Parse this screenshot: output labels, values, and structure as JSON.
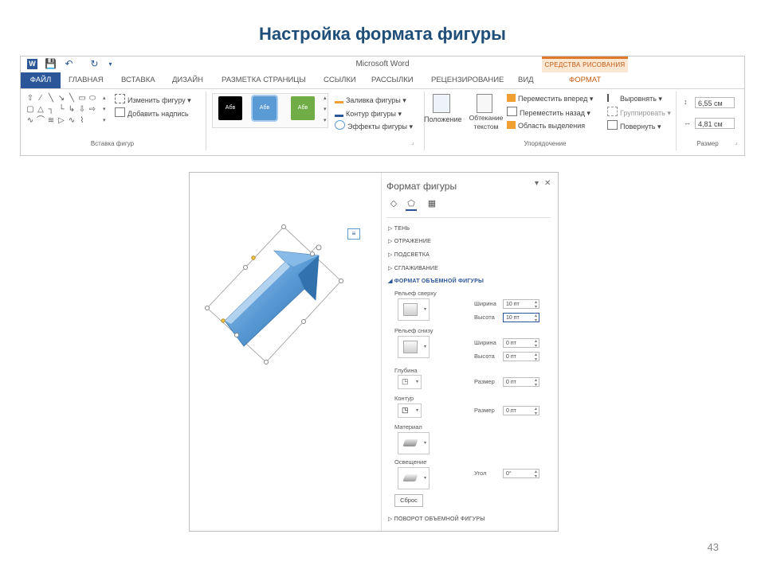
{
  "slide": {
    "title": "Настройка формата фигуры",
    "page_number": "43"
  },
  "window": {
    "title": "Microsoft Word",
    "context_tab": "СРЕДСТВА РИСОВАНИЯ"
  },
  "qat": [
    "word-logo",
    "save-icon",
    "undo-icon",
    "redo-icon",
    "customize-icon"
  ],
  "tabs": [
    "ФАЙЛ",
    "ГЛАВНАЯ",
    "ВСТАВКА",
    "ДИЗАЙН",
    "РАЗМЕТКА СТРАНИЦЫ",
    "ССЫЛКИ",
    "РАССЫЛКИ",
    "РЕЦЕНЗИРОВАНИЕ",
    "ВИД",
    "ФОРМАТ"
  ],
  "ribbon": {
    "insert_shapes": {
      "label": "Вставка фигур",
      "edit_shape": "Изменить фигуру",
      "add_text": "Добавить надпись"
    },
    "styles": {
      "samples": [
        "Абв",
        "Абв",
        "Абв"
      ],
      "sample_colors": [
        "#000000",
        "#5b9bd5",
        "#70ad47"
      ],
      "fill": "Заливка фигуры",
      "outline": "Контур фигуры",
      "effects": "Эффекты фигуры"
    },
    "arrange": {
      "label": "Упорядочение",
      "position": "Положение",
      "wrap": "Обтекание текстом",
      "bring_forward": "Переместить вперед",
      "send_backward": "Переместить назад",
      "selection_pane": "Область выделения",
      "align": "Выровнять",
      "group": "Группировать",
      "rotate": "Повернуть"
    },
    "size": {
      "label": "Размер",
      "height": "6,55 см",
      "width": "4,81 см"
    }
  },
  "pane": {
    "title": "Формат фигуры",
    "sections_collapsed": [
      "ТЕНЬ",
      "ОТРАЖЕНИЕ",
      "ПОДСВЕТКА",
      "СГЛАЖИВАНИЕ"
    ],
    "section_open": "ФОРМАТ ОБЪЕМНОЙ ФИГУРЫ",
    "top_bevel": {
      "label": "Рельеф сверху",
      "width_label": "Ширина",
      "width": "10 пт",
      "height_label": "Высота",
      "height": "10 пт"
    },
    "bottom_bevel": {
      "label": "Рельеф снизу",
      "width_label": "Ширина",
      "width": "0 пт",
      "height_label": "Высота",
      "height": "0 пт"
    },
    "depth": {
      "label": "Глубина",
      "size_label": "Размер",
      "size": "0 пт"
    },
    "contour": {
      "label": "Контур",
      "size_label": "Размер",
      "size": "0 пт"
    },
    "material": {
      "label": "Материал"
    },
    "lighting": {
      "label": "Освещение",
      "angle_label": "Угол",
      "angle": "0°"
    },
    "reset": "Сброс",
    "section_last": "ПОВОРОТ ОБЪЕМНОЙ ФИГУРЫ"
  },
  "colors": {
    "accent": "#2b579a",
    "format_tab": "#c55a11",
    "arrow": "#5b9bd5"
  }
}
